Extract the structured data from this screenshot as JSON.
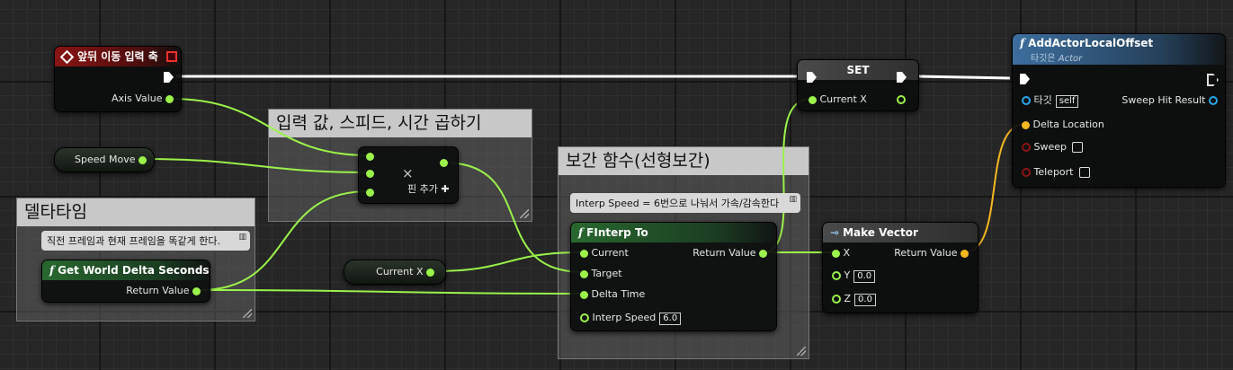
{
  "comments": {
    "multiply": "입력 값, 스피드, 시간 곱하기",
    "interp": "보간 함수(선형보간)",
    "delta": "델타타임"
  },
  "bubbles": {
    "delta": "직전 프레임과 현재 프레임을 똑같게 한다.",
    "interp": "Interp Speed = 6번으로 나눠서 가속/감속한다"
  },
  "axis_node": {
    "title": "앞뒤 이동 입력 축",
    "out_label": "Axis Value",
    "icon": "diamond-event-icon"
  },
  "speed_var": {
    "label": "Speed Move"
  },
  "multiply_node": {
    "symbol": "×",
    "add_pin": "핀 추가"
  },
  "delta_node": {
    "fn_icon": "f",
    "title": "Get World Delta Seconds",
    "out_label": "Return Value"
  },
  "current_x_var": {
    "label": "Current X"
  },
  "interp_node": {
    "fn_icon": "f",
    "title": "FInterp To",
    "pins_in": [
      "Current",
      "Target",
      "Delta Time",
      "Interp Speed"
    ],
    "interp_speed_value": "6.0",
    "out_label": "Return Value"
  },
  "make_vector": {
    "title": "Make Vector",
    "pins": [
      "X",
      "Y",
      "Z"
    ],
    "y_value": "0.0",
    "z_value": "0.0",
    "out_label": "Return Value"
  },
  "set_node": {
    "title": "SET",
    "pin": "Current X"
  },
  "add_offset": {
    "fn_icon": "f",
    "title": "AddActorLocalOffset",
    "subtitle_target": "타깃은",
    "subtitle_class": "Actor",
    "target_label": "타깃",
    "target_value": "self",
    "sweep_hit": "Sweep Hit Result",
    "delta_location": "Delta Location",
    "sweep": "Sweep",
    "teleport": "Teleport"
  },
  "colors": {
    "float": "#9bf24a",
    "vector": "#f5b820",
    "struct": "#27a6ea",
    "bool": "#8a1515",
    "exec": "#ffffff"
  }
}
